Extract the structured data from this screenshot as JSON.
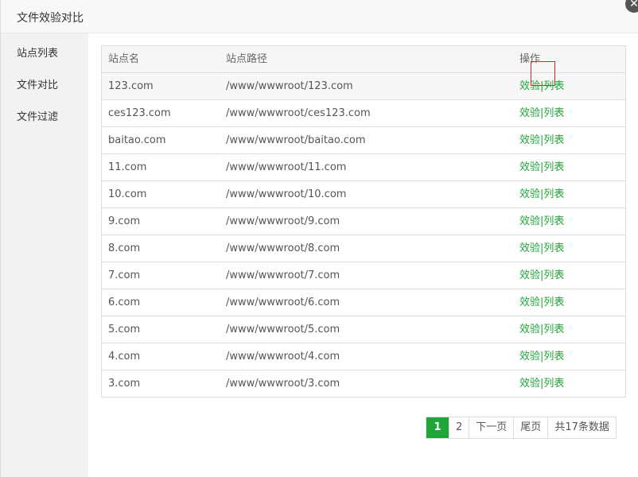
{
  "dialog": {
    "title": "文件效验对比",
    "close_glyph": "✕"
  },
  "sidebar": {
    "items": [
      {
        "label": "站点列表"
      },
      {
        "label": "文件对比"
      },
      {
        "label": "文件过滤"
      }
    ]
  },
  "table": {
    "columns": [
      "站点名",
      "站点路径",
      "操作"
    ],
    "rows": [
      {
        "name": "123.com",
        "path": "/www/wwwroot/123.com"
      },
      {
        "name": "ces123.com",
        "path": "/www/wwwroot/ces123.com"
      },
      {
        "name": "baitao.com",
        "path": "/www/wwwroot/baitao.com"
      },
      {
        "name": "11.com",
        "path": "/www/wwwroot/11.com"
      },
      {
        "name": "10.com",
        "path": "/www/wwwroot/10.com"
      },
      {
        "name": "9.com",
        "path": "/www/wwwroot/9.com"
      },
      {
        "name": "8.com",
        "path": "/www/wwwroot/8.com"
      },
      {
        "name": "7.com",
        "path": "/www/wwwroot/7.com"
      },
      {
        "name": "6.com",
        "path": "/www/wwwroot/6.com"
      },
      {
        "name": "5.com",
        "path": "/www/wwwroot/5.com"
      },
      {
        "name": "4.com",
        "path": "/www/wwwroot/4.com"
      },
      {
        "name": "3.com",
        "path": "/www/wwwroot/3.com"
      }
    ],
    "action_verify": "效验",
    "action_separator": "|",
    "action_list": "列表"
  },
  "pagination": {
    "current": "1",
    "page2": "2",
    "next": "下一页",
    "last": "尾页",
    "total": "共17条数据"
  },
  "colors": {
    "accent": "#20a53a",
    "highlight": "#d8242a"
  }
}
